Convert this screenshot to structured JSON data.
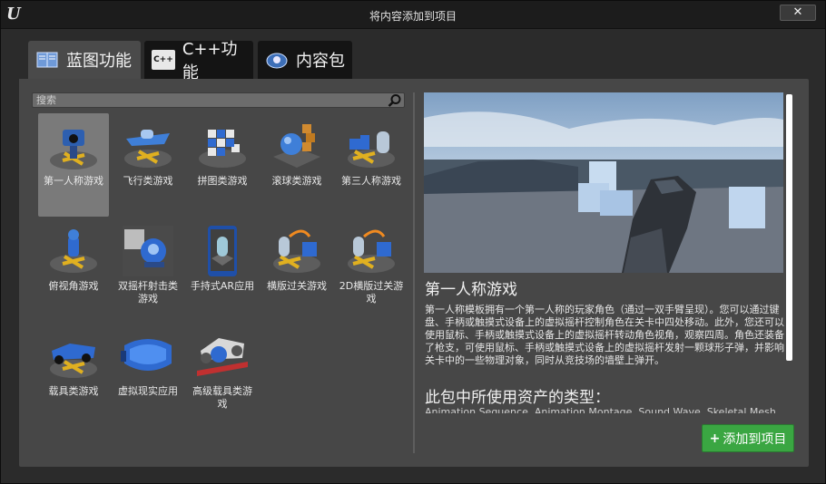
{
  "window": {
    "title": "将内容添加到项目",
    "close_label": "✕"
  },
  "tabs": [
    {
      "label": "蓝图功能",
      "icon": "blueprint-book-icon",
      "active": true
    },
    {
      "label": "C++功能",
      "icon": "cpp-icon",
      "active": false
    },
    {
      "label": "内容包",
      "icon": "content-pack-icon",
      "active": false
    }
  ],
  "cpp_icon_text": "C++",
  "search": {
    "placeholder": "搜索",
    "value": ""
  },
  "templates": [
    {
      "label": "第一人称游戏",
      "icon": "first-person-icon",
      "selected": true
    },
    {
      "label": "飞行类游戏",
      "icon": "flying-icon",
      "selected": false
    },
    {
      "label": "拼图类游戏",
      "icon": "puzzle-icon",
      "selected": false
    },
    {
      "label": "滚球类游戏",
      "icon": "rolling-icon",
      "selected": false
    },
    {
      "label": "第三人称游戏",
      "icon": "third-person-icon",
      "selected": false
    },
    {
      "label": "俯视角游戏",
      "icon": "top-down-icon",
      "selected": false
    },
    {
      "label": "双摇杆射击类游戏",
      "icon": "twin-stick-icon",
      "selected": false
    },
    {
      "label": "手持式AR应用",
      "icon": "handheld-ar-icon",
      "selected": false
    },
    {
      "label": "横版过关游戏",
      "icon": "side-scroller-icon",
      "selected": false
    },
    {
      "label": "2D横版过关游戏",
      "icon": "2d-side-scroller-icon",
      "selected": false
    },
    {
      "label": "载具类游戏",
      "icon": "vehicle-icon",
      "selected": false
    },
    {
      "label": "虚拟现实应用",
      "icon": "vr-headset-icon",
      "selected": false
    },
    {
      "label": "高级载具类游戏",
      "icon": "advanced-vehicle-icon",
      "selected": false
    }
  ],
  "detail": {
    "title": "第一人称游戏",
    "description": "第一人称模板拥有一个第一人称的玩家角色（通过一双手臂呈现）。您可以通过键盘、手柄或触摸式设备上的虚拟摇杆控制角色在关卡中四处移动。此外，您还可以使用鼠标、手柄或触摸式设备上的虚拟摇杆转动角色视角，观察四周。角色还装备了枪支，可使用鼠标、手柄或触摸式设备上的虚拟摇杆发射一颗球形子弹，并影响关卡中的一些物理对象，同时从竞技场的墙壁上弹开。",
    "assets_heading": "此包中所使用资产的类型：",
    "assets_list": "Animation Sequence, Animation Montage, Sound Wave, Skeletal Mesh"
  },
  "add_button": {
    "label": "添加到项目"
  },
  "colors": {
    "accent_green": "#3aa642",
    "panel": "#474747",
    "selected_tile": "#7a7a7a"
  }
}
